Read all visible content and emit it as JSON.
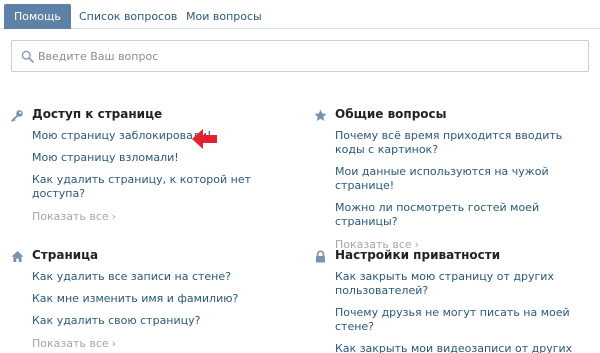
{
  "tabs": [
    {
      "label": "Помощь",
      "active": true
    },
    {
      "label": "Список вопросов",
      "active": false
    },
    {
      "label": "Мои вопросы",
      "active": false
    }
  ],
  "search": {
    "placeholder": "Введите Ваш вопрос",
    "icon": "search-icon"
  },
  "sections": {
    "access": {
      "title": "Доступ к странице",
      "icon": "key-icon",
      "items": [
        "Мою страницу заблокировали!",
        "Мою страницу взломали!",
        "Как удалить страницу, к которой нет доступа?"
      ],
      "show_all": "Показать все"
    },
    "general": {
      "title": "Общие вопросы",
      "icon": "star-icon",
      "items": [
        "Почему всё время приходится вводить коды с картинок?",
        "Мои данные используются на чужой странице!",
        "Можно ли посмотреть гостей моей страницы?"
      ],
      "show_all": "Показать все"
    },
    "page": {
      "title": "Страница",
      "icon": "home-icon",
      "items": [
        "Как удалить все записи на стене?",
        "Как мне изменить имя и фамилию?",
        "Как удалить свою страницу?"
      ],
      "show_all": "Показать все"
    },
    "privacy": {
      "title": "Настройки приватности",
      "icon": "lock-icon",
      "items": [
        "Как закрыть мою страницу от других пользователей?",
        "Почему друзья не могут писать на моей стене?",
        "Как закрыть мои видеозаписи от других пользователей?"
      ]
    }
  },
  "colors": {
    "tab_active_bg": "#5e81a8",
    "link": "#2b587a",
    "muted": "#a0a8b0",
    "icon": "#7b92ad",
    "arrow": "#e3222b"
  }
}
